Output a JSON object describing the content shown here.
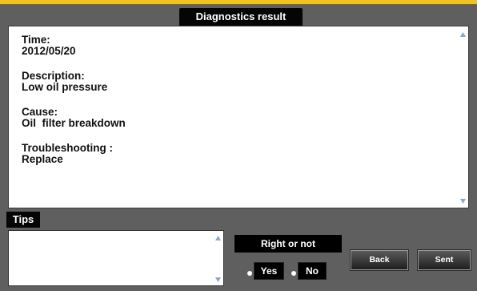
{
  "window": {
    "title": "Diagnostics result"
  },
  "result": {
    "fields": [
      {
        "label": "Time:",
        "value": "2012/05/20"
      },
      {
        "label": "Description:",
        "value": "Low oil pressure"
      },
      {
        "label": "Cause:",
        "value": "Oil  filter breakdown"
      },
      {
        "label": "Troubleshooting :",
        "value": "Replace"
      }
    ]
  },
  "tips": {
    "label": "Tips",
    "value": ""
  },
  "feedback": {
    "prompt": "Right or not",
    "yes_label": "Yes",
    "no_label": "No"
  },
  "actions": {
    "back_label": "Back",
    "sent_label": "Sent"
  },
  "icons": {
    "scroll_up": "scroll-up-arrow-icon",
    "scroll_down": "scroll-down-arrow-icon",
    "radio": "radio-dot-icon"
  },
  "colors": {
    "accent": "#f0c419",
    "panel_bg": "#ffffff",
    "frame_bg": "#5f5f5f",
    "tab_bg": "#050505"
  }
}
